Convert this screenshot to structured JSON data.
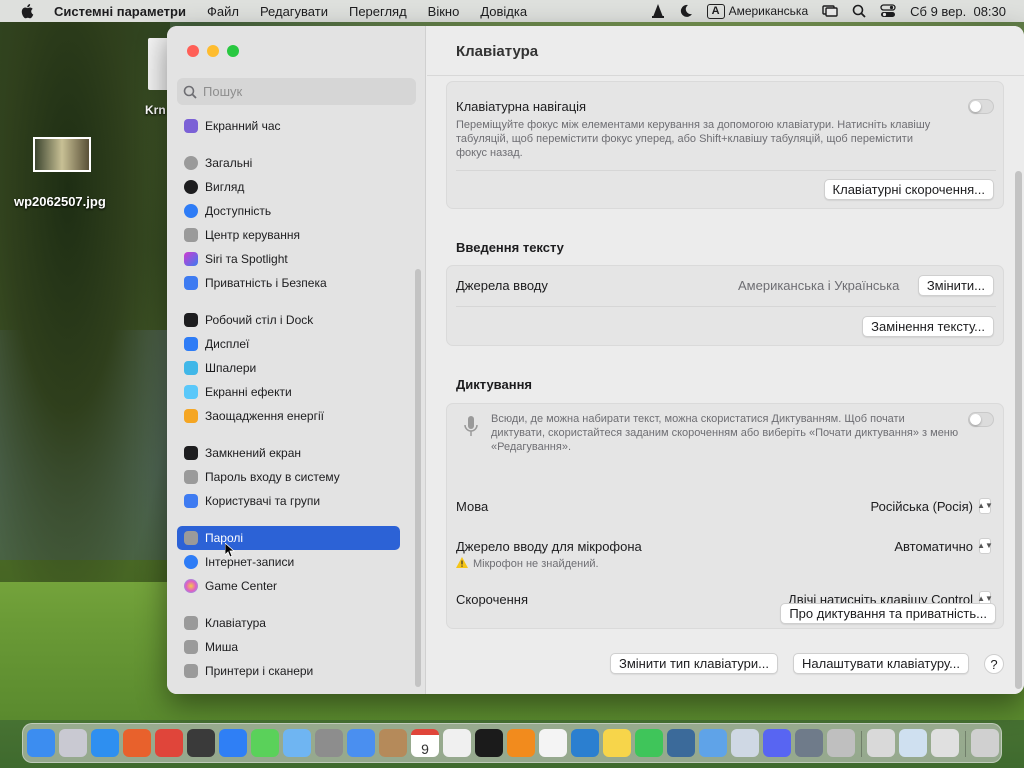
{
  "menubar": {
    "app_name": "Системні параметри",
    "menus": [
      "Файл",
      "Редагувати",
      "Перегляд",
      "Вікно",
      "Довідка"
    ],
    "keyboard_badge": "A",
    "input_source": "Американська",
    "datetime": "Сб 9 вер.  08:30"
  },
  "desktop": {
    "file_label": "wp2062507.jpg",
    "partial_label": "Krn"
  },
  "sidebar": {
    "search_placeholder": "Пошук",
    "items": [
      {
        "label": "Екранний час",
        "color": "#7b61d6"
      },
      {
        "label": "Загальні",
        "color": "#9a9a9a"
      },
      {
        "label": "Вигляд",
        "color": "#1d1d1f"
      },
      {
        "label": "Доступність",
        "color": "#2e7cf6"
      },
      {
        "label": "Центр керування",
        "color": "#9a9a9a"
      },
      {
        "label": "Siri та Spotlight",
        "color": "#d13ad0"
      },
      {
        "label": "Приватність і Безпека",
        "color": "#3e7bf1"
      },
      {
        "label": "Робочий стіл і Dock",
        "color": "#1d1d1f"
      },
      {
        "label": "Дисплеї",
        "color": "#2e7cf6"
      },
      {
        "label": "Шпалери",
        "color": "#40b7e8"
      },
      {
        "label": "Екранні ефекти",
        "color": "#5ac8fa"
      },
      {
        "label": "Заощадження енергії",
        "color": "#f5a623"
      },
      {
        "label": "Замкнений екран",
        "color": "#1d1d1f"
      },
      {
        "label": "Пароль входу в систему",
        "color": "#9a9a9a"
      },
      {
        "label": "Користувачі та групи",
        "color": "#3e7bf1"
      },
      {
        "label": "Паролі",
        "color": "#9a9a9a"
      },
      {
        "label": "Інтернет-записи",
        "color": "#2e7cf6"
      },
      {
        "label": "Game Center",
        "color": "#e05dc4"
      },
      {
        "label": "Клавіатура",
        "color": "#9a9a9a"
      },
      {
        "label": "Миша",
        "color": "#9a9a9a"
      },
      {
        "label": "Принтери і сканери",
        "color": "#9a9a9a"
      }
    ],
    "active_index": 15
  },
  "content": {
    "title": "Клавіатура",
    "keyboard_nav": {
      "label": "Клавіатурна навігація",
      "description": "Переміщуйте фокус між елементами керування за допомогою клавіатури. Натисніть клавішу табуляцій, щоб перемістити фокус уперед, або Shift+клавішу табуляцій, щоб перемістити фокус назад.",
      "enabled": false,
      "shortcuts_button": "Клавіатурні скорочення..."
    },
    "text_input": {
      "section_title": "Введення тексту",
      "sources_label": "Джерела вводу",
      "sources_value": "Американська і Українська",
      "change_button": "Змінити...",
      "replacements_button": "Замінення тексту..."
    },
    "dictation": {
      "section_title": "Диктування",
      "description": "Всюди, де можна набирати текст, можна скористатися Диктуванням. Щоб почати диктувати, скористайтеся заданим скороченням або виберіть «Почати диктування» з меню «Редагування».",
      "enabled": false,
      "language_label": "Мова",
      "language_value": "Російська (Росія)",
      "mic_label": "Джерело вводу для мікрофона",
      "mic_value": "Автоматично",
      "mic_warning": "Мікрофон не знайдений.",
      "shortcut_label": "Скорочення",
      "shortcut_value": "Двічі натисніть клавішу Control",
      "privacy_button": "Про диктування та приватність..."
    },
    "footer": {
      "change_type_button": "Змінити тип клавіатури...",
      "setup_button": "Налаштувати клавіатуру...",
      "help_label": "?"
    }
  },
  "dock": {
    "apps": [
      {
        "name": "finder-icon",
        "color": "#3c8df0"
      },
      {
        "name": "launchpad-icon",
        "color": "#c9c9d2"
      },
      {
        "name": "safari-icon",
        "color": "#2e8ff0"
      },
      {
        "name": "firefox-icon",
        "color": "#e8612c"
      },
      {
        "name": "chrome-icon",
        "color": "#e0453a"
      },
      {
        "name": "guitar-icon",
        "color": "#3a3a3a"
      },
      {
        "name": "app-store-icon",
        "color": "#2f7ff5"
      },
      {
        "name": "messages-icon",
        "color": "#5ad15a"
      },
      {
        "name": "maps-icon",
        "color": "#6fb5f2"
      },
      {
        "name": "system-settings-icon",
        "color": "#8d8d8d"
      },
      {
        "name": "mail-icon",
        "color": "#4a8ff0"
      },
      {
        "name": "contacts-icon",
        "color": "#b58a5a"
      },
      {
        "name": "calendar-icon",
        "color": "#ffffff"
      },
      {
        "name": "textedit-icon",
        "color": "#f0f0f0"
      },
      {
        "name": "terminal-icon",
        "color": "#1b1b1b"
      },
      {
        "name": "vlc-icon",
        "color": "#f28b1d"
      },
      {
        "name": "reminders-icon",
        "color": "#f4f4f4"
      },
      {
        "name": "vscode-icon",
        "color": "#2b7fd0"
      },
      {
        "name": "notes-icon",
        "color": "#f7d54a"
      },
      {
        "name": "facetime-icon",
        "color": "#3fc55a"
      },
      {
        "name": "quicktime-icon",
        "color": "#3b6a9a"
      },
      {
        "name": "folder-icon",
        "color": "#5fa3e8"
      },
      {
        "name": "preview-icon",
        "color": "#cfd8e4"
      },
      {
        "name": "discord-icon",
        "color": "#5865f2"
      },
      {
        "name": "printer-icon",
        "color": "#6f7b8a"
      },
      {
        "name": "automator-icon",
        "color": "#bfbfbf"
      },
      {
        "name": "window-icon-1",
        "color": "#d9d9d9"
      },
      {
        "name": "window-icon-2",
        "color": "#cfe0f0"
      },
      {
        "name": "window-icon-3",
        "color": "#e0e0e0"
      },
      {
        "name": "trash-icon",
        "color": "#d0d0d0"
      }
    ],
    "calendar_day": "9"
  }
}
